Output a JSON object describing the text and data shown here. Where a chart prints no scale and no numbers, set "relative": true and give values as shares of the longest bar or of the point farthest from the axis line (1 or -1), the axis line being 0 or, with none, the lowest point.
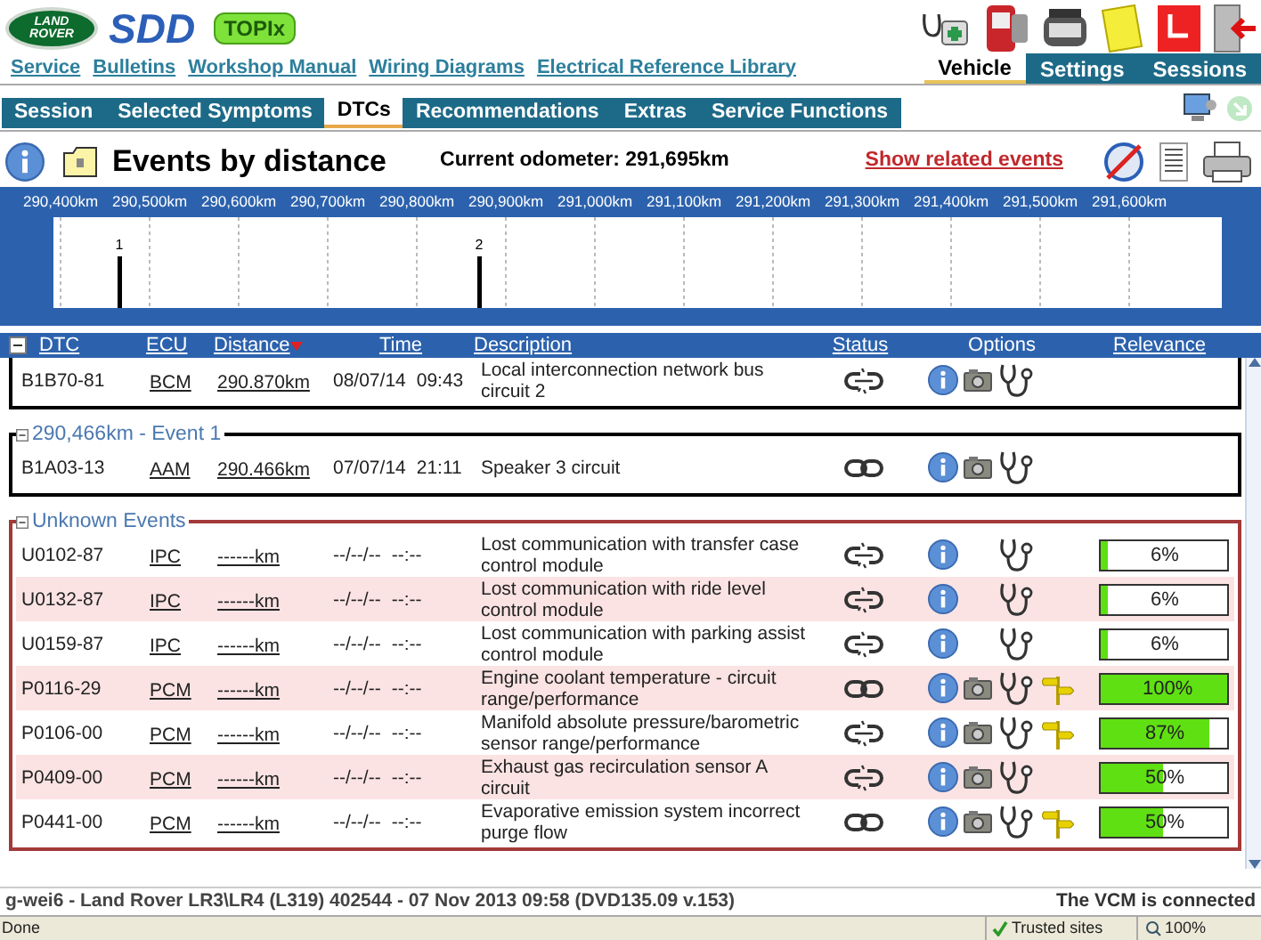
{
  "logo": {
    "brand_lines": [
      "LAND",
      "ROVER"
    ],
    "app_name": "SDD",
    "badge": "TOPIx"
  },
  "links": [
    "Service",
    "Bulletins",
    "Workshop Manual",
    "Wiring Diagrams",
    "Electrical Reference Library"
  ],
  "top_tabs": [
    {
      "label": "Vehicle",
      "selected": true
    },
    {
      "label": "Settings",
      "selected": false
    },
    {
      "label": "Sessions",
      "selected": false
    }
  ],
  "nav_tabs": [
    {
      "label": "Session",
      "selected": false
    },
    {
      "label": "Selected Symptoms",
      "selected": false
    },
    {
      "label": "DTCs",
      "selected": true
    },
    {
      "label": "Recommendations",
      "selected": false
    },
    {
      "label": "Extras",
      "selected": false
    },
    {
      "label": "Service Functions",
      "selected": false
    }
  ],
  "page": {
    "title": "Events by distance",
    "odometer": "Current odometer: 291,695km",
    "related_link": "Show related events"
  },
  "timeline": {
    "chart_data": {
      "type": "bar",
      "x": [
        290466,
        290870
      ],
      "values": [
        1,
        1
      ],
      "relative": true,
      "grid": true,
      "xlim": [
        290392,
        291704
      ],
      "xticks": [
        {
          "value": 290400,
          "label": "290,400km"
        },
        {
          "value": 290500,
          "label": "290,500km"
        },
        {
          "value": 290600,
          "label": "290,600km"
        },
        {
          "value": 290700,
          "label": "290,700km"
        },
        {
          "value": 290800,
          "label": "290,800km"
        },
        {
          "value": 290900,
          "label": "290,900km"
        },
        {
          "value": 291000,
          "label": "291,000km"
        },
        {
          "value": 291100,
          "label": "291,100km"
        },
        {
          "value": 291200,
          "label": "291,200km"
        },
        {
          "value": 291300,
          "label": "291,300km"
        },
        {
          "value": 291400,
          "label": "291,400km"
        },
        {
          "value": 291500,
          "label": "291,500km"
        },
        {
          "value": 291600,
          "label": "291,600km"
        }
      ],
      "annotations": [
        "1",
        "2"
      ]
    }
  },
  "table": {
    "columns": [
      {
        "label": "DTC",
        "sortable": true,
        "sorted": false
      },
      {
        "label": "ECU",
        "sortable": true,
        "sorted": false
      },
      {
        "label": "Distance",
        "sortable": true,
        "sorted": true
      },
      {
        "label": "Time",
        "sortable": true,
        "sorted": false
      },
      {
        "label": "Description",
        "sortable": true,
        "sorted": false
      },
      {
        "label": "Status",
        "sortable": true,
        "sorted": false
      },
      {
        "label": "Options",
        "sortable": false,
        "sorted": false
      },
      {
        "label": "Relevance",
        "sortable": true,
        "sorted": false
      }
    ],
    "groups": [
      {
        "kind": "event",
        "rows": [
          {
            "dtc": "B1B70-81",
            "ecu": "BCM",
            "distance": "290.870km",
            "date": "08/07/14",
            "time": "09:43",
            "description": "Local interconnection network bus circuit 2",
            "link_broken": true,
            "camera": true,
            "signpost": false
          }
        ]
      },
      {
        "kind": "event",
        "title": "290,466km - Event 1",
        "rows": [
          {
            "dtc": "B1A03-13",
            "ecu": "AAM",
            "distance": "290.466km",
            "date": "07/07/14",
            "time": "21:11",
            "description": "Speaker 3 circuit",
            "link_broken": false,
            "camera": true,
            "signpost": false
          }
        ]
      },
      {
        "kind": "unknown",
        "title": "Unknown Events",
        "rows": [
          {
            "dtc": "U0102-87",
            "ecu": "IPC",
            "distance": "------km",
            "date": "--/--/--",
            "time": "--:--",
            "description": "Lost communication with transfer case control module",
            "link_broken": true,
            "camera": false,
            "signpost": false,
            "relevance": {
              "text": "6%",
              "level": 0.06
            }
          },
          {
            "dtc": "U0132-87",
            "ecu": "IPC",
            "distance": "------km",
            "date": "--/--/--",
            "time": "--:--",
            "description": "Lost communication with ride level control module",
            "link_broken": true,
            "camera": false,
            "signpost": false,
            "relevance": {
              "text": "6%",
              "level": 0.06
            }
          },
          {
            "dtc": "U0159-87",
            "ecu": "IPC",
            "distance": "------km",
            "date": "--/--/--",
            "time": "--:--",
            "description": "Lost communication with parking assist control module",
            "link_broken": true,
            "camera": false,
            "signpost": false,
            "relevance": {
              "text": "6%",
              "level": 0.06
            }
          },
          {
            "dtc": "P0116-29",
            "ecu": "PCM",
            "distance": "------km",
            "date": "--/--/--",
            "time": "--:--",
            "description": "Engine coolant temperature - circuit range/performance",
            "link_broken": false,
            "camera": true,
            "signpost": true,
            "relevance": {
              "text": "100%",
              "level": 1
            }
          },
          {
            "dtc": "P0106-00",
            "ecu": "PCM",
            "distance": "------km",
            "date": "--/--/--",
            "time": "--:--",
            "description": "Manifold absolute pressure/barometric sensor range/performance",
            "link_broken": true,
            "camera": true,
            "signpost": true,
            "relevance": {
              "text": "87%",
              "level": 0.87
            }
          },
          {
            "dtc": "P0409-00",
            "ecu": "PCM",
            "distance": "------km",
            "date": "--/--/--",
            "time": "--:--",
            "description": "Exhaust gas recirculation sensor A circuit",
            "link_broken": true,
            "camera": true,
            "signpost": false,
            "relevance": {
              "text": "50%",
              "level": 0.5
            }
          },
          {
            "dtc": "P0441-00",
            "ecu": "PCM",
            "distance": "------km",
            "date": "--/--/--",
            "time": "--:--",
            "description": "Evaporative emission system incorrect purge flow",
            "link_broken": false,
            "camera": true,
            "signpost": true,
            "relevance": {
              "text": "50%",
              "level": 0.5
            }
          }
        ]
      }
    ]
  },
  "footer": {
    "session": "g-wei6 - Land Rover LR3\\LR4 (L319) 402544 - 07 Nov 2013 09:58 (DVD135.09 v.153)",
    "connection": "The VCM is connected"
  },
  "browser_status": {
    "text": "Done",
    "zone": "Trusted sites",
    "zoom": "100%"
  }
}
